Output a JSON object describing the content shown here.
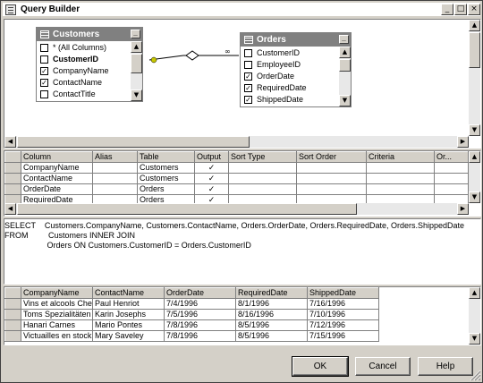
{
  "window": {
    "title": "Query Builder"
  },
  "diagram": {
    "tables": [
      {
        "name": "Customers",
        "columns": [
          {
            "label": "* (All Columns)",
            "checked": false,
            "bold": false
          },
          {
            "label": "CustomerID",
            "checked": false,
            "bold": true
          },
          {
            "label": "CompanyName",
            "checked": true,
            "bold": false
          },
          {
            "label": "ContactName",
            "checked": true,
            "bold": false
          },
          {
            "label": "ContactTitle",
            "checked": false,
            "bold": false
          }
        ]
      },
      {
        "name": "Orders",
        "columns": [
          {
            "label": "CustomerID",
            "checked": false,
            "bold": false
          },
          {
            "label": "EmployeeID",
            "checked": false,
            "bold": false
          },
          {
            "label": "OrderDate",
            "checked": true,
            "bold": false
          },
          {
            "label": "RequiredDate",
            "checked": true,
            "bold": false
          },
          {
            "label": "ShippedDate",
            "checked": true,
            "bold": false
          }
        ]
      }
    ]
  },
  "criteria_grid": {
    "headers": [
      "Column",
      "Alias",
      "Table",
      "Output",
      "Sort Type",
      "Sort Order",
      "Criteria",
      "Or..."
    ],
    "rows": [
      {
        "column": "CompanyName",
        "alias": "",
        "table": "Customers",
        "output": "✓"
      },
      {
        "column": "ContactName",
        "alias": "",
        "table": "Customers",
        "output": "✓"
      },
      {
        "column": "OrderDate",
        "alias": "",
        "table": "Orders",
        "output": "✓"
      },
      {
        "column": "RequiredDate",
        "alias": "",
        "table": "Orders",
        "output": "✓"
      }
    ]
  },
  "sql": {
    "line1_kw": "SELECT",
    "line1": "Customers.CompanyName, Customers.ContactName, Orders.OrderDate, Orders.RequiredDate, Orders.ShippedDate",
    "line2_kw": "FROM",
    "line2": "Customers INNER JOIN",
    "line3": "Orders ON Customers.CustomerID = Orders.CustomerID"
  },
  "results": {
    "headers": [
      "CompanyName",
      "ContactName",
      "OrderDate",
      "RequiredDate",
      "ShippedDate"
    ],
    "rows": [
      [
        "Vins et alcools Chev",
        "Paul Henriot",
        "7/4/1996",
        "8/1/1996",
        "7/16/1996"
      ],
      [
        "Toms Spezialitäten",
        "Karin Josephs",
        "7/5/1996",
        "8/16/1996",
        "7/10/1996"
      ],
      [
        "Hanari Carnes",
        "Mario Pontes",
        "7/8/1996",
        "8/5/1996",
        "7/12/1996"
      ],
      [
        "Victuailles en stock",
        "Mary Saveley",
        "7/8/1996",
        "8/5/1996",
        "7/15/1996"
      ]
    ]
  },
  "buttons": {
    "ok": "OK",
    "cancel": "Cancel",
    "help": "Help"
  }
}
